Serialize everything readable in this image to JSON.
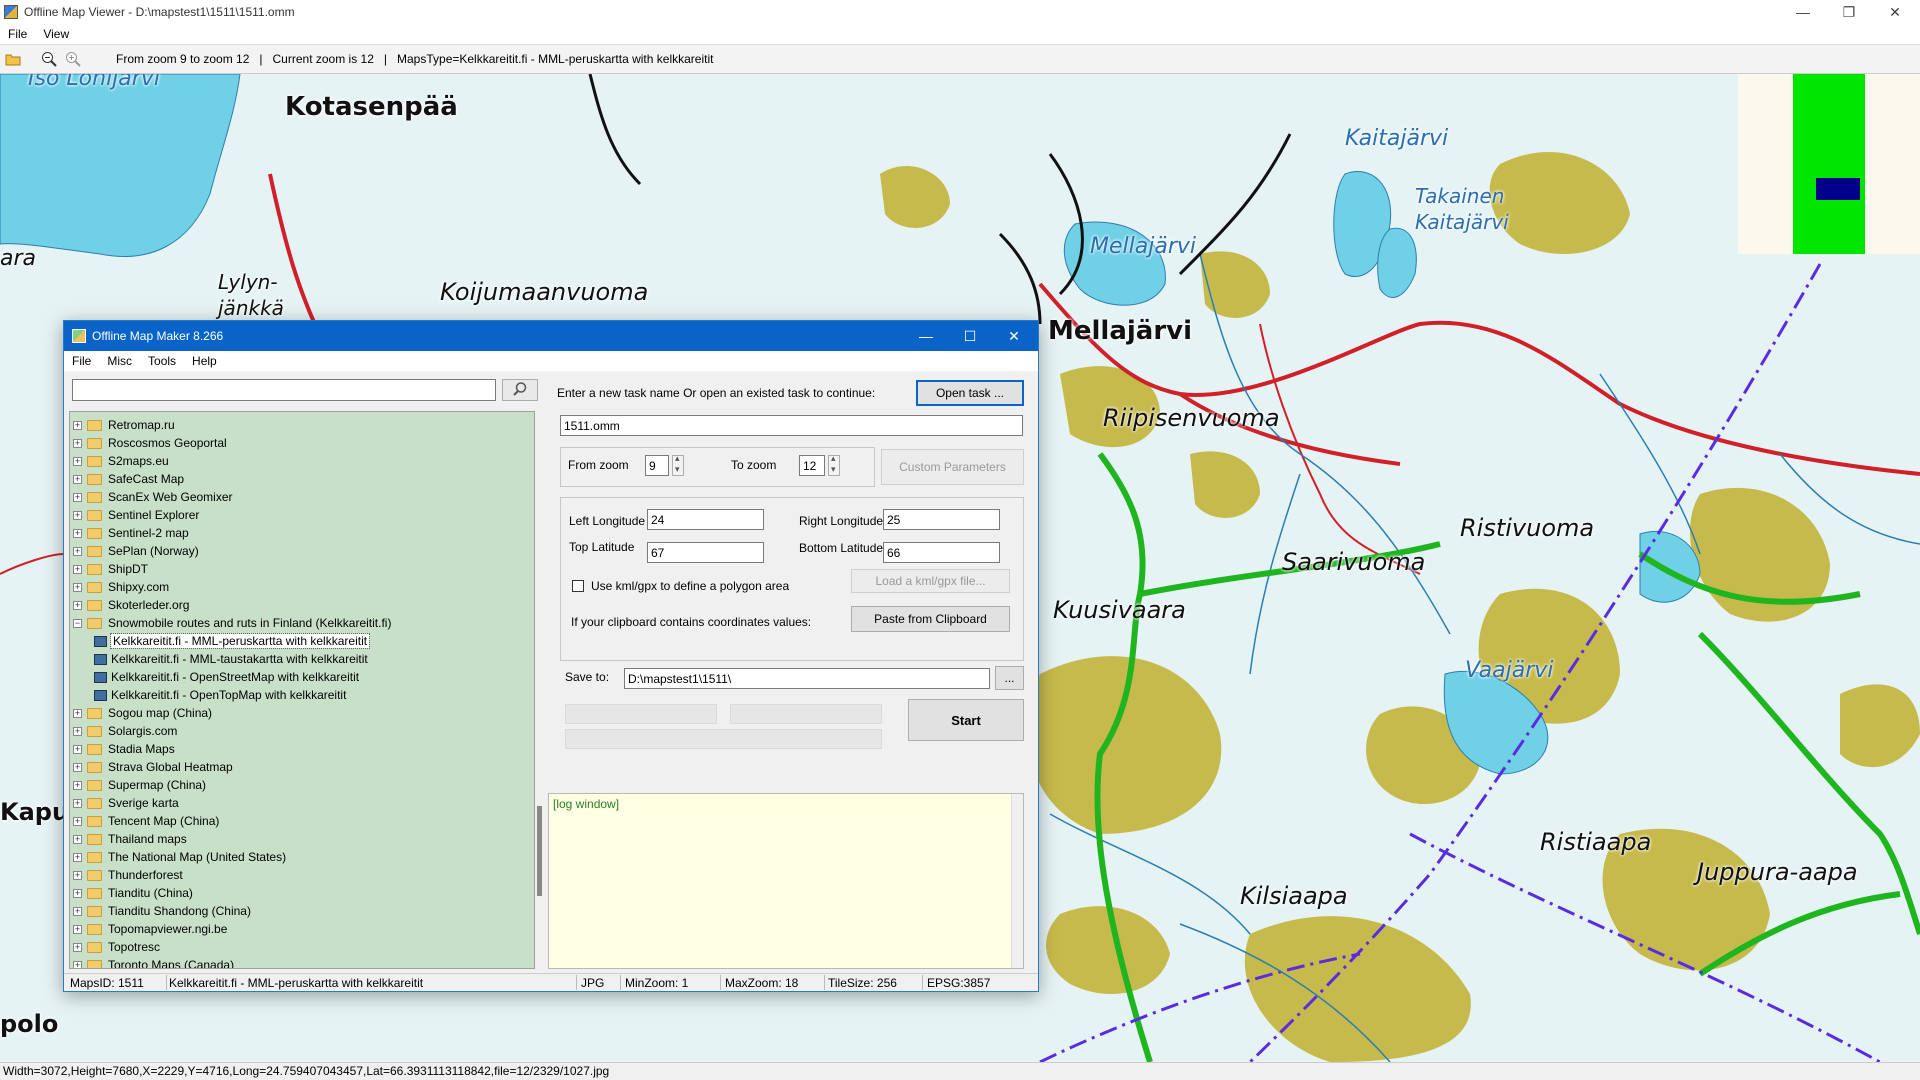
{
  "window": {
    "title": "Offline Map Viewer - D:\\mapstest1\\1511\\1511.omm"
  },
  "menu": [
    "File",
    "View"
  ],
  "toolbar": {
    "zoom_range": "From zoom 9 to zoom 12",
    "separator": "|",
    "current_zoom": "Current zoom is 12",
    "maps_type": "MapsType=Kelkkareitit.fi - MML-peruskartta with kelkkareitit"
  },
  "map_labels": {
    "iso_lohijarvi": "Iso Lohijärvi",
    "kotasenpaa": "Kotasenpää",
    "kaitajarvi": "Kaitajärvi",
    "takainen": "Takainen",
    "kaitajarvi2": "Kaitajärvi",
    "mellajarvi_lake": "Mellajärvi",
    "ara": "ara",
    "lylyn": "Lylyn-",
    "jankka": "jänkkä",
    "koijumaanvuoma": "Koijumaanvuoma",
    "mellajarvi_village": "Mellajärvi",
    "riipisenvuoma": "Riipisenvuoma",
    "ristivuoma": "Ristivuoma",
    "saarivuoma": "Saarivuoma",
    "kuusivaara": "Kuusivaara",
    "vaajarvi": "Vaajärvi",
    "kapu": "Kapu",
    "ristiaapa": "Ristiaapa",
    "juppura_aapa": "Juppura-aapa",
    "kilsiaapa": "Kilsiaapa",
    "pololo": "polo"
  },
  "statusbar": "Width=3072,Height=7680,X=2229,Y=4716,Long=24.759407043457,Lat=66.3931113118842,file=12/2329/1027.jpg",
  "dialog": {
    "title": "Offline Map Maker 8.266",
    "menu": [
      "File",
      "Misc",
      "Tools",
      "Help"
    ],
    "search_value": "",
    "tree": [
      {
        "label": "Retromap.ru",
        "expander": "+"
      },
      {
        "label": "Roscosmos Geoportal",
        "expander": "+"
      },
      {
        "label": "S2maps.eu",
        "expander": "+"
      },
      {
        "label": "SafeCast Map",
        "expander": "+"
      },
      {
        "label": "ScanEx Web Geomixer",
        "expander": "+"
      },
      {
        "label": "Sentinel Explorer",
        "expander": "+"
      },
      {
        "label": "Sentinel-2 map",
        "expander": "+"
      },
      {
        "label": "SePlan (Norway)",
        "expander": "+"
      },
      {
        "label": "ShipDT",
        "expander": "+"
      },
      {
        "label": "Shipxy.com",
        "expander": "+"
      },
      {
        "label": "Skoterleder.org",
        "expander": "+"
      },
      {
        "label": "Snowmobile routes and ruts in Finland (Kelkkareitit.fi)",
        "expander": "−"
      },
      {
        "label": "Kelkkareitit.fi - MML-peruskartta with kelkkareitit",
        "child": true,
        "selected": true
      },
      {
        "label": "Kelkkareitit.fi - MML-taustakartta with kelkkareitit",
        "child": true
      },
      {
        "label": "Kelkkareitit.fi - OpenStreetMap with kelkkareitit",
        "child": true
      },
      {
        "label": "Kelkkareitit.fi - OpenTopMap with kelkkareitit",
        "child": true
      },
      {
        "label": "Sogou map (China)",
        "expander": "+"
      },
      {
        "label": "Solargis.com",
        "expander": "+"
      },
      {
        "label": "Stadia Maps",
        "expander": "+"
      },
      {
        "label": "Strava Global Heatmap",
        "expander": "+"
      },
      {
        "label": "Supermap (China)",
        "expander": "+"
      },
      {
        "label": "Sverige karta",
        "expander": "+"
      },
      {
        "label": "Tencent Map (China)",
        "expander": "+"
      },
      {
        "label": "Thailand maps",
        "expander": "+"
      },
      {
        "label": "The National Map (United States)",
        "expander": "+"
      },
      {
        "label": "Thunderforest",
        "expander": "+"
      },
      {
        "label": "Tianditu (China)",
        "expander": "+"
      },
      {
        "label": "Tianditu Shandong (China)",
        "expander": "+"
      },
      {
        "label": "Topomapviewer.ngi.be",
        "expander": "+"
      },
      {
        "label": "Topotresc",
        "expander": "+"
      },
      {
        "label": "Toronto Maps (Canada)",
        "expander": "+"
      }
    ],
    "task_prompt": "Enter a new task name Or open an existed task to continue:",
    "open_task_label": "Open task ...",
    "task_name": "1511.omm",
    "from_zoom_label": "From zoom",
    "from_zoom_value": "9",
    "to_zoom_label": "To zoom",
    "to_zoom_value": "12",
    "custom_params_label": "Custom Parameters",
    "left_lon_label": "Left Longitude",
    "left_lon_value": "24",
    "right_lon_label": "Right Longitude",
    "right_lon_value": "25",
    "top_lat_label": "Top Latitude",
    "top_lat_value": "67",
    "bottom_lat_label": "Bottom Latitude",
    "bottom_lat_value": "66",
    "kml_check_label": "Use kml/gpx to define a polygon area",
    "load_kml_label": "Load a kml/gpx file...",
    "clipboard_prompt": "If your clipboard contains coordinates values:",
    "paste_label": "Paste from Clipboard",
    "save_to_label": "Save to:",
    "save_to_value": "D:\\mapstest1\\1511\\",
    "browse_label": "...",
    "start_label": "Start",
    "log_text": "[log window]",
    "status": {
      "maps_id": "MapsID: 1511",
      "map_name": "Kelkkareitit.fi - MML-peruskartta with kelkkareitit",
      "format": "JPG",
      "min_zoom": "MinZoom: 1",
      "max_zoom": "MaxZoom: 18",
      "tile_size": "TileSize: 256",
      "epsg": "EPSG:3857"
    }
  },
  "icons": {
    "title_min": "—",
    "title_max": "❐",
    "title_close": "✕",
    "dlg_min": "—",
    "dlg_max": "☐",
    "dlg_close": "✕",
    "search": "⌕"
  },
  "colors": {
    "dialog_titlebar": "#0a64c8",
    "tree_bg": "#c8e0c8",
    "log_bg": "#ffffe4",
    "map_road": "#d0212a",
    "map_boundary": "#1fb51f",
    "map_water": "#6fd0e6",
    "map_wetland": "#c3b43a",
    "map_border_line": "#5a2ce0"
  }
}
